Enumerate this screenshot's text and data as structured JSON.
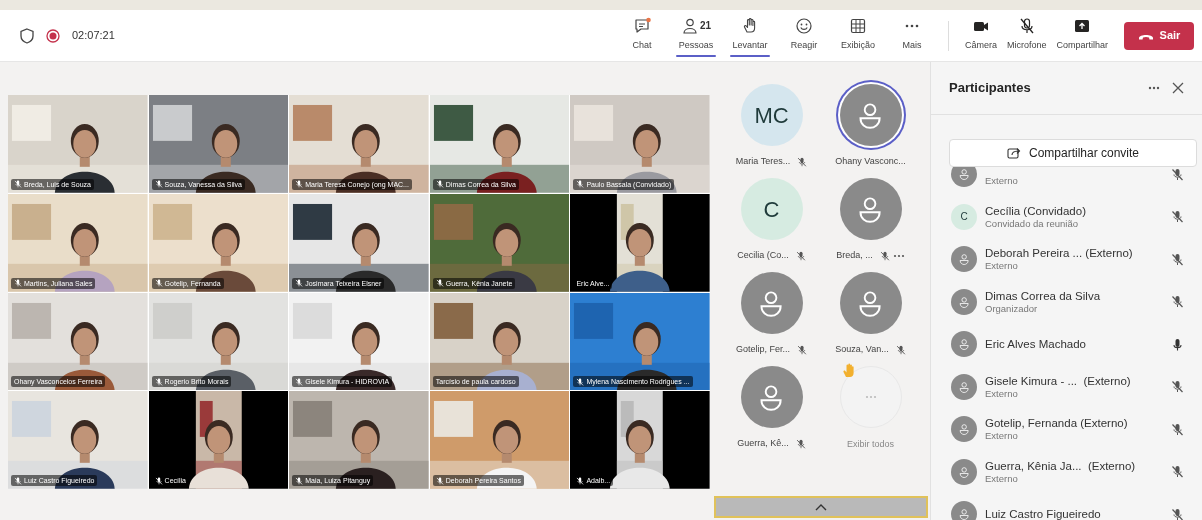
{
  "toolbar": {
    "timer": "02:07:21",
    "recording": true,
    "items": [
      {
        "kind": "chat",
        "label": "Chat",
        "badge": true,
        "selected": false
      },
      {
        "kind": "people",
        "label": "Pessoas",
        "count": "21",
        "badge": false,
        "selected": true
      },
      {
        "kind": "hand",
        "label": "Levantar",
        "badge": false,
        "selected": true
      },
      {
        "kind": "react",
        "label": "Reagir",
        "badge": false,
        "selected": false
      },
      {
        "kind": "view",
        "label": "Exibição",
        "badge": false,
        "selected": false
      },
      {
        "kind": "more",
        "label": "Mais",
        "badge": false,
        "selected": false
      }
    ],
    "devices": [
      {
        "kind": "camera",
        "label": "Câmera",
        "off": false
      },
      {
        "kind": "mic",
        "label": "Microfone",
        "off": true
      },
      {
        "kind": "share",
        "label": "Compartilhar",
        "off": false
      }
    ],
    "leave": "Sair"
  },
  "video_tiles": [
    {
      "name": "Breda, Luis de Souza",
      "muted": true,
      "kind": "full"
    },
    {
      "name": "Souza, Vanessa da Silva",
      "muted": true,
      "kind": "full"
    },
    {
      "name": "Maria Teresa Conejo (ong MAC...",
      "muted": true,
      "kind": "full"
    },
    {
      "name": "Dimas Correa da Silva",
      "muted": true,
      "kind": "full"
    },
    {
      "name": "Paulo Bassala (Convidado)",
      "muted": true,
      "kind": "full"
    },
    {
      "name": "Martins, Juliana Sales",
      "muted": true,
      "kind": "full"
    },
    {
      "name": "Gotelip, Fernanda",
      "muted": true,
      "kind": "full"
    },
    {
      "name": "Josimara Teixeira Elsner",
      "muted": true,
      "kind": "full"
    },
    {
      "name": "Guerra, Kênia Janete",
      "muted": true,
      "kind": "full"
    },
    {
      "name": "Eric Alve...",
      "muted": false,
      "kind": "narrow"
    },
    {
      "name": "Ohany Vasconcelos Ferreira",
      "muted": false,
      "kind": "full"
    },
    {
      "name": "Rogerio Brito Morais",
      "muted": true,
      "kind": "full"
    },
    {
      "name": "Gisele Kimura - HIDROVIA",
      "muted": true,
      "kind": "full"
    },
    {
      "name": "Tarcísio de paula cardoso",
      "muted": false,
      "kind": "full"
    },
    {
      "name": "Mylena Nascimento Rodrigues ...",
      "muted": true,
      "kind": "full"
    },
    {
      "name": "Luiz Castro Figueiredo",
      "muted": true,
      "kind": "full"
    },
    {
      "name": "Cecília",
      "muted": true,
      "kind": "narrow"
    },
    {
      "name": "Maia, Luiza Pitanguy",
      "muted": true,
      "kind": "full"
    },
    {
      "name": "Deborah Pereira Santos",
      "muted": true,
      "kind": "full"
    },
    {
      "name": "Adalb...",
      "muted": true,
      "kind": "narrow"
    }
  ],
  "audio_tiles": [
    {
      "name": "Maria Teres...",
      "kind": "initials",
      "initials": "MC",
      "color": "#d5e6ee",
      "muted": true,
      "speaking": false,
      "more": false
    },
    {
      "name": "Ohany Vasconc...",
      "kind": "person",
      "muted": false,
      "speaking": true,
      "more": false
    },
    {
      "name": "Cecilia (Co...",
      "kind": "initials",
      "initials": "C",
      "color": "#d6ebe1",
      "muted": true,
      "speaking": false,
      "more": false
    },
    {
      "name": "Breda, ...",
      "kind": "person",
      "muted": true,
      "speaking": false,
      "more": true
    },
    {
      "name": "Gotelip, Fer...",
      "kind": "person",
      "muted": true,
      "speaking": false,
      "more": false
    },
    {
      "name": "Souza, Van...",
      "kind": "person",
      "muted": true,
      "speaking": false,
      "more": false
    },
    {
      "name": "Guerra, Kê...",
      "kind": "person",
      "muted": true,
      "speaking": false,
      "more": false
    }
  ],
  "show_all": {
    "label": "Exibir todos",
    "hand_raised": true
  },
  "panel": {
    "title": "Participantes",
    "invite": "Compartilhar convite",
    "people": [
      {
        "role": "Externo",
        "kind": "person",
        "muted": true
      },
      {
        "name": "Cecília (Convidado)",
        "role": "Convidado da reunião",
        "kind": "initials",
        "initials": "C",
        "color": "#d6ebe1",
        "muted": true
      },
      {
        "name": "Deborah Pereira ... (Externo)",
        "role": "Externo",
        "kind": "person",
        "muted": true
      },
      {
        "name": "Dimas Correa da Silva",
        "role": "Organizador",
        "kind": "person",
        "muted": true
      },
      {
        "name": "Eric Alves Machado",
        "kind": "person",
        "muted": false
      },
      {
        "name": "Gisele Kimura - ...  (Externo)",
        "role": "Externo",
        "kind": "person",
        "muted": true
      },
      {
        "name": "Gotelip, Fernanda (Externo)",
        "role": "Externo",
        "kind": "person",
        "muted": true
      },
      {
        "name": "Guerra, Kênia Ja...  (Externo)",
        "role": "Externo",
        "kind": "person",
        "muted": true
      },
      {
        "name": "Luiz Castro Figueiredo",
        "kind": "person",
        "muted": true
      }
    ]
  }
}
